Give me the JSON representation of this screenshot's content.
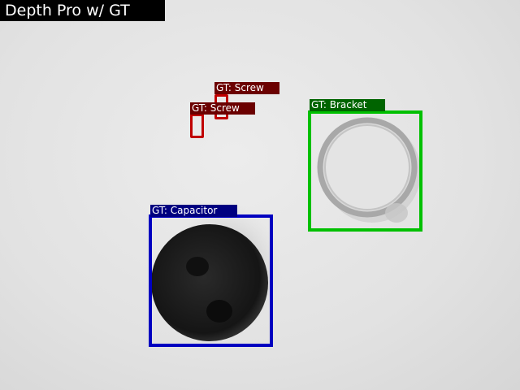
{
  "title": "Depth Pro w/ GT",
  "annotations": [
    {
      "label": "GT: Screw",
      "color": "#c00000",
      "label_bg": "#6b0000"
    },
    {
      "label": "GT: Screw",
      "color": "#c00000",
      "label_bg": "#6b0000"
    },
    {
      "label": "GT: Bracket",
      "color": "#00c000",
      "label_bg": "#006400"
    },
    {
      "label": "GT: Capacitor",
      "color": "#0000c0",
      "label_bg": "#000080"
    }
  ]
}
